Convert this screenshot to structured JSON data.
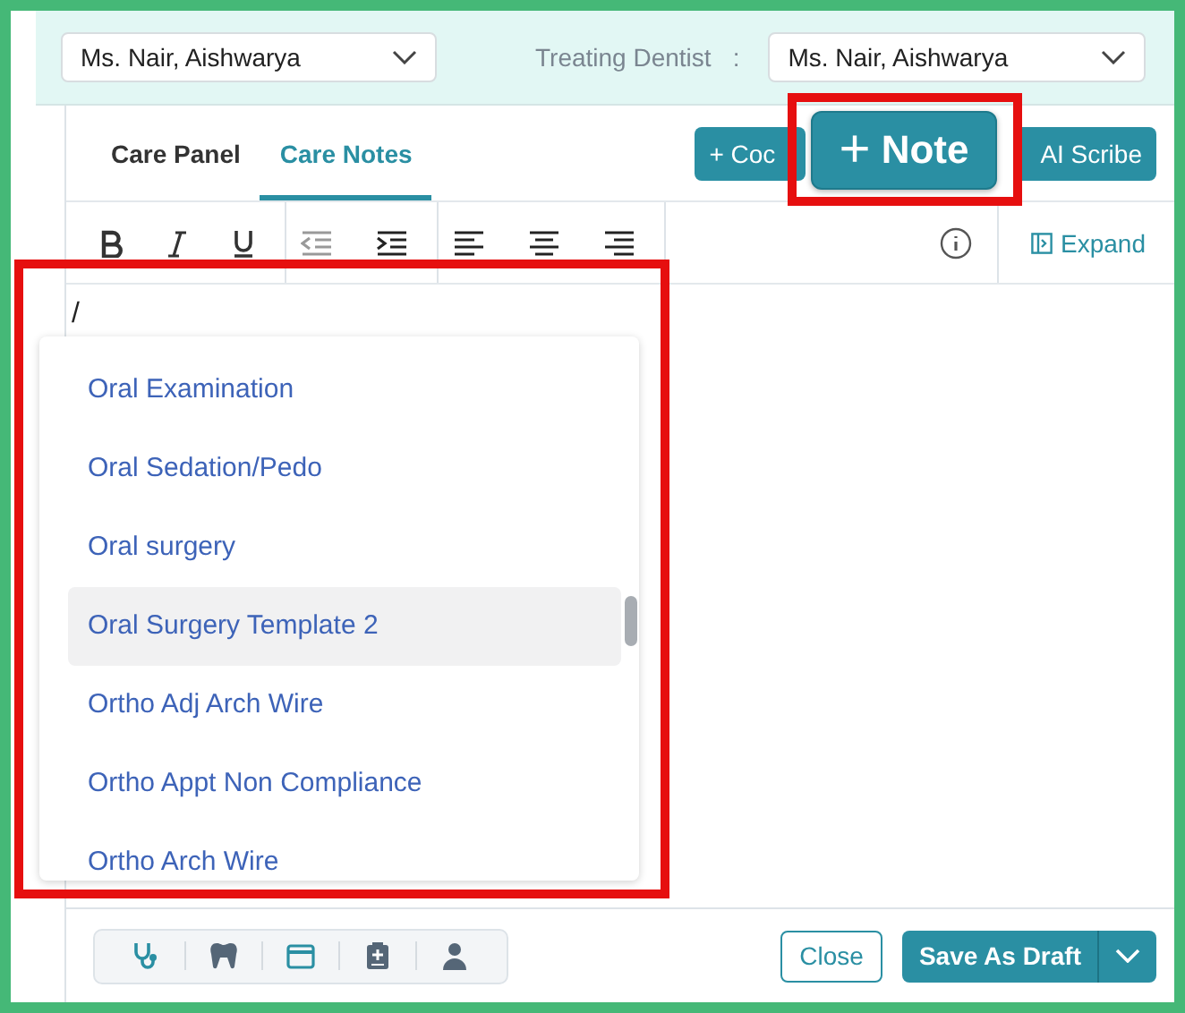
{
  "header": {
    "provider_select": {
      "value": "Ms. Nair, Aishwarya"
    },
    "treating_dentist": {
      "label": "Treating Dentist",
      "separator": ":",
      "value": "Ms. Nair, Aishwarya"
    }
  },
  "tabs": [
    {
      "label": "Care Panel",
      "selected": false
    },
    {
      "label": "Care Notes",
      "selected": true
    }
  ],
  "actions": [
    {
      "label": "+ Coc"
    },
    {
      "label": "AI Scribe"
    }
  ],
  "note_button": {
    "icon": "+",
    "label": "Note"
  },
  "toolbar": {
    "expand": "Expand"
  },
  "editor": {
    "value": "/"
  },
  "templates": [
    {
      "label": "Oral Examination",
      "selected": false
    },
    {
      "label": "Oral Sedation/Pedo",
      "selected": false
    },
    {
      "label": "Oral surgery",
      "selected": false
    },
    {
      "label": "Oral Surgery Template 2",
      "selected": true
    },
    {
      "label": "Ortho Adj Arch Wire",
      "selected": false
    },
    {
      "label": "Ortho Appt Non Compliance",
      "selected": false
    },
    {
      "label": "Ortho Arch Wire",
      "selected": false
    }
  ],
  "footer": {
    "close": "Close",
    "save": "Save As Draft"
  }
}
